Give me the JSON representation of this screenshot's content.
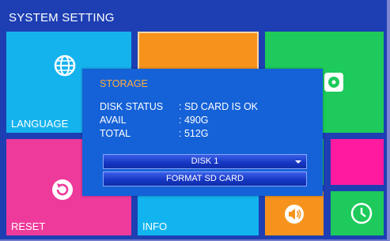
{
  "header": {
    "title": "SYSTEM SETTING"
  },
  "tiles": {
    "language": "LANGUAGE",
    "reset": "RESET",
    "info": "INFO"
  },
  "icons": {
    "language": "globe-icon",
    "reset": "reset-icon",
    "storage": "disk-icon",
    "volume": "speaker-icon",
    "clock": "clock-icon"
  },
  "storage_dialog": {
    "title": "STORAGE",
    "disk_status_label": "DISK STATUS",
    "disk_status_value": ": SD CARD IS OK",
    "avail_label": "AVAIL",
    "avail_value": ": 490G",
    "total_label": "TOTAL",
    "total_value": ": 512G",
    "disk_select": "DISK 1",
    "format_button": "FORMAT SD CARD"
  },
  "colors": {
    "background": "#1d3fb3",
    "language_tile": "#15b3ee",
    "orange_tile": "#f7931c",
    "green_tile": "#1dca5b",
    "pink_tile": "#ee3a9a",
    "magenta_tile": "#ff1aa0",
    "dialog": "#1562d8",
    "dialog_title": "#ffab3a"
  }
}
